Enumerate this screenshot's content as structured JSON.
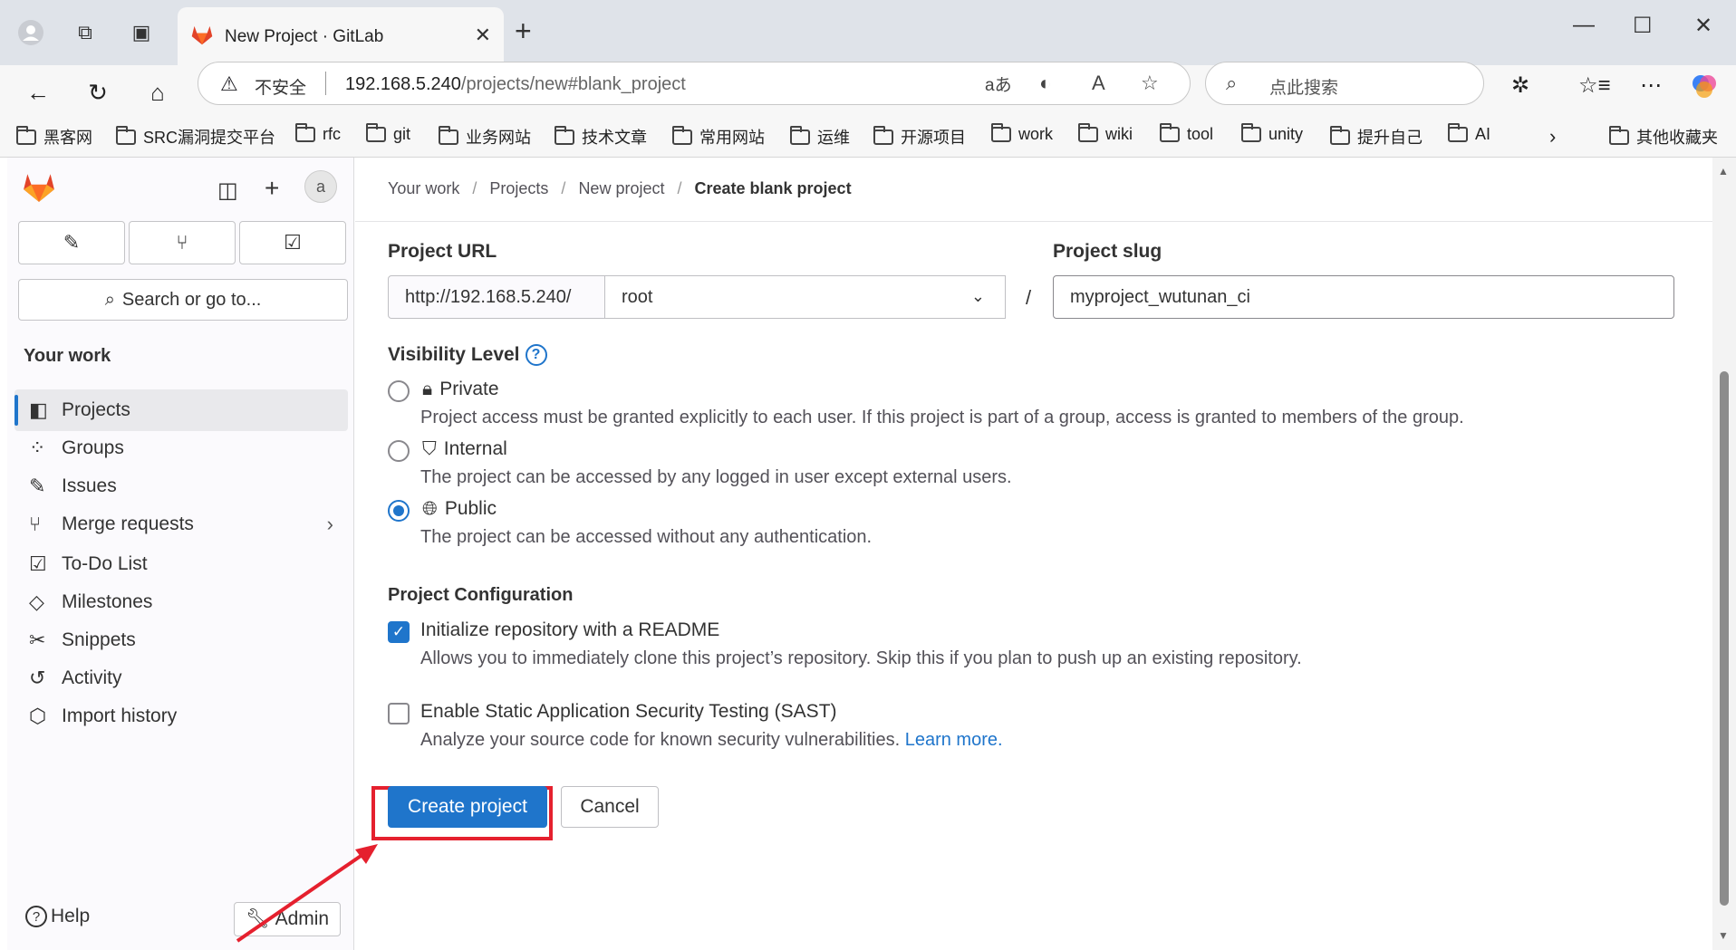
{
  "browser": {
    "tab_title": "New Project · GitLab",
    "insecure_label": "不安全",
    "url_host": "192.168.5.240",
    "url_path": "/projects/new#blank_project",
    "search_placeholder": "点此搜索",
    "bookmarks": [
      "黑客网",
      "SRC漏洞提交平台",
      "rfc",
      "git",
      "业务网站",
      "技术文章",
      "常用网站",
      "运维",
      "开源项目",
      "work",
      "wiki",
      "tool",
      "unity",
      "提升自己",
      "AI"
    ],
    "other_bookmarks": "其他收藏夹"
  },
  "sidebar": {
    "search_label": "Search or go to...",
    "avatar_text": "a",
    "section_heading": "Your work",
    "items": [
      {
        "label": "Projects",
        "icon": "project-icon"
      },
      {
        "label": "Groups",
        "icon": "group-icon"
      },
      {
        "label": "Issues",
        "icon": "issues-icon"
      },
      {
        "label": "Merge requests",
        "icon": "merge-request-icon"
      },
      {
        "label": "To-Do List",
        "icon": "todo-icon"
      },
      {
        "label": "Milestones",
        "icon": "milestone-icon"
      },
      {
        "label": "Snippets",
        "icon": "snippet-icon"
      },
      {
        "label": "Activity",
        "icon": "history-icon"
      },
      {
        "label": "Import history",
        "icon": "import-icon"
      }
    ],
    "help_label": "Help",
    "admin_label": "Admin"
  },
  "breadcrumb": [
    "Your work",
    "Projects",
    "New project",
    "Create blank project"
  ],
  "form": {
    "project_url_label": "Project URL",
    "url_prefix": "http://192.168.5.240/",
    "namespace": "root",
    "project_slug_label": "Project slug",
    "project_slug_value": "myproject_wutunan_ci",
    "visibility_label": "Visibility Level",
    "visibility_options": [
      {
        "label": "Private",
        "desc": "Project access must be granted explicitly to each user. If this project is part of a group, access is granted to members of the group.",
        "checked": false
      },
      {
        "label": "Internal",
        "desc": "The project can be accessed by any logged in user except external users.",
        "checked": false
      },
      {
        "label": "Public",
        "desc": "The project can be accessed without any authentication.",
        "checked": true
      }
    ],
    "config_label": "Project Configuration",
    "readme_label": "Initialize repository with a README",
    "readme_desc": "Allows you to immediately clone this project’s repository. Skip this if you plan to push up an existing repository.",
    "sast_label": "Enable Static Application Security Testing (SAST)",
    "sast_desc": "Analyze your source code for known security vulnerabilities.",
    "learn_more": "Learn more.",
    "create_button": "Create project",
    "cancel_button": "Cancel"
  },
  "colors": {
    "accent": "#1f75cb",
    "highlight": "#e5202e"
  }
}
